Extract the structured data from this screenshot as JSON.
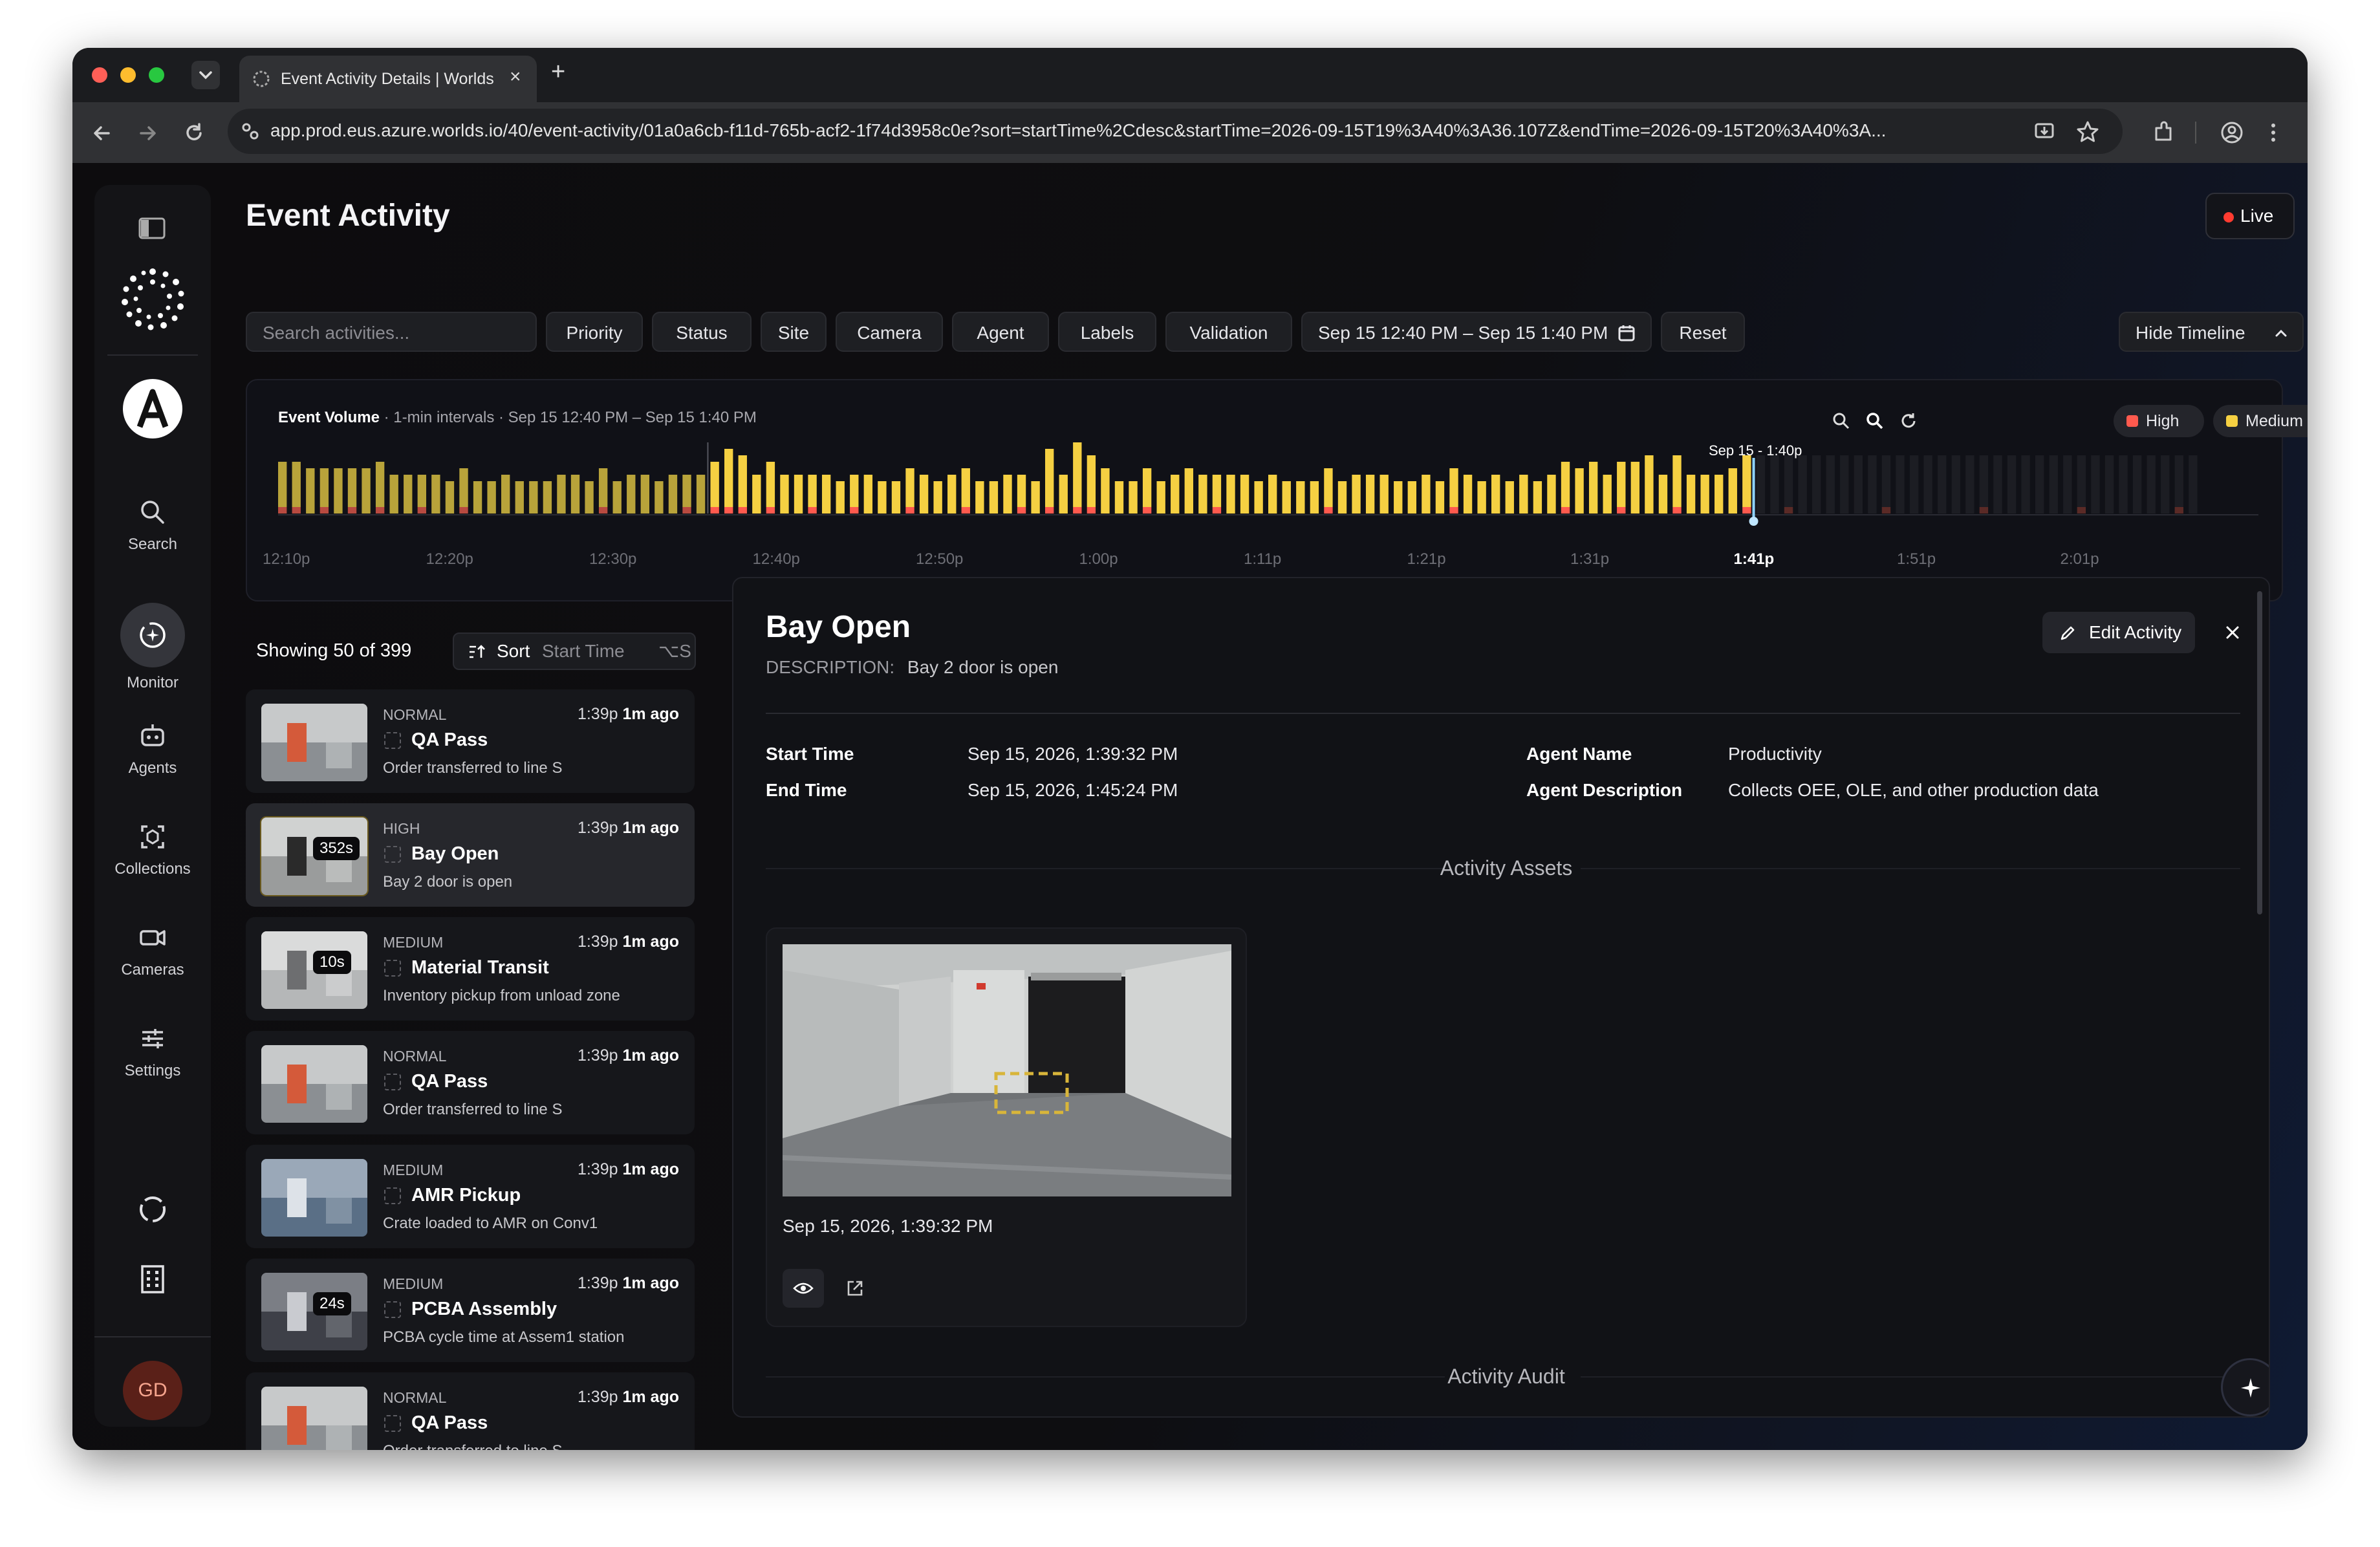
{
  "browser": {
    "tab_title": "Event Activity Details | Worlds",
    "url": "app.prod.eus.azure.worlds.io/40/event-activity/01a0a6cb-f11d-765b-acf2-1f74d3958c0e?sort=startTime%2Cdesc&startTime=2026-09-15T19%3A40%3A36.107Z&endTime=2026-09-15T20%3A40%3A..."
  },
  "sidebar": {
    "items": [
      {
        "label": "Search",
        "icon": "search-icon"
      },
      {
        "label": "Monitor",
        "icon": "monitor-icon"
      },
      {
        "label": "Agents",
        "icon": "robot-icon"
      },
      {
        "label": "Collections",
        "icon": "collections-icon"
      },
      {
        "label": "Cameras",
        "icon": "camera-icon"
      },
      {
        "label": "Settings",
        "icon": "sliders-icon"
      }
    ],
    "avatar_initials": "GD"
  },
  "header": {
    "title": "Event Activity",
    "live_label": "Live",
    "search_placeholder": "Search activities...",
    "filters": [
      "Priority",
      "Status",
      "Site",
      "Camera",
      "Agent",
      "Labels",
      "Validation"
    ],
    "date_range": "Sep 15 12:40 PM – Sep 15 1:40 PM",
    "reset_label": "Reset",
    "hide_timeline_label": "Hide Timeline"
  },
  "timeline": {
    "title": "Event Volume",
    "subtitle": " · 1-min intervals · Sep 15 12:40 PM – Sep 15 1:40 PM",
    "legend": [
      {
        "label": "High",
        "color": "#ff5a4e"
      },
      {
        "label": "Medium",
        "color": "#f5d042"
      }
    ],
    "cursor_label": "Sep 15 - 1:40p",
    "x_ticks": [
      "12:10p",
      "12:20p",
      "12:30p",
      "12:40p",
      "12:50p",
      "1:00p",
      "1:11p",
      "1:21p",
      "1:31p",
      "1:41p",
      "1:51p",
      "2:01p"
    ]
  },
  "chart_data": {
    "type": "bar",
    "x_start": "12:10p",
    "interval": "1 min",
    "series": [
      {
        "name": "Medium",
        "values": [
          7,
          7,
          7,
          6,
          7,
          6,
          7,
          7,
          6,
          6,
          5,
          6,
          5,
          6,
          5,
          5,
          6,
          5,
          5,
          5,
          6,
          6,
          5,
          6,
          5,
          6,
          6,
          5,
          6,
          5,
          6,
          7,
          9,
          8,
          6,
          7,
          6,
          6,
          5,
          6,
          5,
          5,
          6,
          5,
          5,
          6,
          6,
          5,
          6,
          6,
          5,
          5,
          6,
          5,
          5,
          9,
          6,
          10,
          8,
          7,
          5,
          5,
          6,
          5,
          6,
          7,
          6,
          5,
          6,
          6,
          5,
          6,
          5,
          5,
          5,
          6,
          5,
          6,
          6,
          6,
          5,
          5,
          6,
          5,
          6,
          6,
          5,
          6,
          5,
          6,
          5,
          6,
          7,
          7,
          8,
          6,
          7,
          8,
          9,
          6,
          8,
          6,
          6,
          6,
          7,
          8,
          0,
          0,
          0,
          0,
          0,
          0,
          0,
          0,
          0,
          0,
          0,
          0,
          0,
          0,
          0,
          0,
          0,
          0,
          0,
          0,
          0,
          0,
          0,
          0,
          0,
          0,
          0,
          0,
          0,
          0,
          0,
          0,
          0,
          0,
          0,
          0
        ]
      },
      {
        "name": "High",
        "values": [
          1,
          1,
          0,
          1,
          0,
          1,
          0,
          1,
          0,
          0,
          1,
          0,
          0,
          1,
          0,
          0,
          0,
          0,
          0,
          0,
          0,
          0,
          0,
          1,
          0,
          0,
          0,
          0,
          0,
          1,
          0,
          1,
          1,
          1,
          0,
          1,
          0,
          0,
          1,
          0,
          0,
          1,
          0,
          0,
          0,
          1,
          0,
          0,
          0,
          1,
          0,
          0,
          0,
          1,
          0,
          1,
          0,
          1,
          1,
          0,
          0,
          0,
          1,
          0,
          0,
          0,
          0,
          1,
          0,
          0,
          0,
          0,
          0,
          0,
          0,
          1,
          0,
          0,
          0,
          0,
          0,
          0,
          0,
          0,
          1,
          0,
          0,
          0,
          0,
          0,
          0,
          0,
          1,
          0,
          0,
          0,
          1,
          0,
          0,
          0,
          1,
          0,
          0,
          0,
          0,
          1,
          0,
          0,
          0,
          0,
          0,
          0,
          0,
          0,
          0,
          0,
          0,
          0,
          0,
          0,
          0,
          0,
          0,
          0,
          0,
          0,
          0,
          0,
          0,
          0,
          0,
          0,
          0,
          0,
          0,
          0,
          0,
          0
        ]
      }
    ],
    "ylim": [
      0,
      10
    ]
  },
  "list": {
    "showing": "Showing 50 of 399",
    "sort_label": "Sort",
    "sort_field": "Start Time",
    "sort_shortcut": "⌥S",
    "items": [
      {
        "severity": "NORMAL",
        "time": "1:39p",
        "ago": "1m ago",
        "title": "QA Pass",
        "desc": "Order transferred to line S",
        "badge": ""
      },
      {
        "severity": "HIGH",
        "time": "1:39p",
        "ago": "1m ago",
        "title": "Bay Open",
        "desc": "Bay 2 door is open",
        "badge": "352s"
      },
      {
        "severity": "MEDIUM",
        "time": "1:39p",
        "ago": "1m ago",
        "title": "Material Transit",
        "desc": "Inventory pickup from unload zone",
        "badge": "10s"
      },
      {
        "severity": "NORMAL",
        "time": "1:39p",
        "ago": "1m ago",
        "title": "QA Pass",
        "desc": "Order transferred to line S",
        "badge": ""
      },
      {
        "severity": "MEDIUM",
        "time": "1:39p",
        "ago": "1m ago",
        "title": "AMR Pickup",
        "desc": "Crate loaded to AMR on Conv1",
        "badge": ""
      },
      {
        "severity": "MEDIUM",
        "time": "1:39p",
        "ago": "1m ago",
        "title": "PCBA Assembly",
        "desc": "PCBA cycle time at Assem1 station",
        "badge": "24s"
      },
      {
        "severity": "NORMAL",
        "time": "1:39p",
        "ago": "1m ago",
        "title": "QA Pass",
        "desc": "Order transferred to line S",
        "badge": ""
      }
    ]
  },
  "detail": {
    "title": "Bay Open",
    "description_label": "DESCRIPTION:",
    "description": "Bay 2 door is open",
    "edit_label": "Edit Activity",
    "start_time_label": "Start Time",
    "start_time": "Sep 15, 2026, 1:39:32 PM",
    "end_time_label": "End Time",
    "end_time": "Sep 15, 2026, 1:45:24 PM",
    "agent_name_label": "Agent Name",
    "agent_name": "Productivity",
    "agent_desc_label": "Agent Description",
    "agent_desc": "Collects OEE, OLE, and other production data",
    "assets_title": "Activity Assets",
    "asset_time": "Sep 15, 2026, 1:39:32 PM",
    "audit_title": "Activity Audit"
  }
}
